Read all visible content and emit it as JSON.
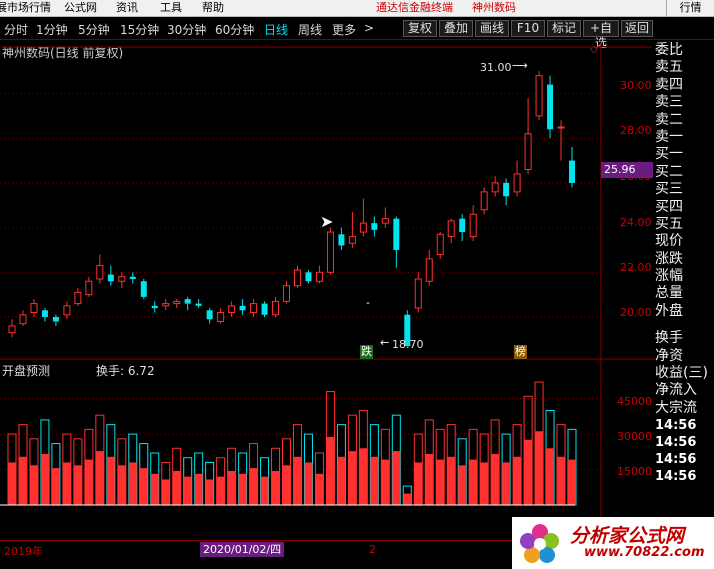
{
  "menubar": {
    "items": [
      "展市场行情",
      "公式网",
      "资讯",
      "工具",
      "帮助"
    ],
    "center_items": [
      "通达信金融终端",
      "神州数码"
    ],
    "right_button": "行情"
  },
  "toolbar": {
    "periods": [
      "分时",
      "1分钟",
      "5分钟",
      "15分钟",
      "30分钟",
      "60分钟",
      "日线",
      "周线",
      "更多",
      ">"
    ],
    "active_period": "日线",
    "buttons": [
      "复权",
      "叠加",
      "画线",
      "F10",
      "标记",
      "+自选",
      "返回"
    ]
  },
  "chart": {
    "title": "神州数码(日线 前复权)",
    "price_axis": [
      "30.00",
      "28.00",
      "26.00",
      "24.00",
      "22.00",
      "20.00"
    ],
    "current_price": "25.96",
    "high_label": "31.00",
    "low_label": "18.70",
    "marker_down": "跌",
    "marker_rank": "榜"
  },
  "sidepanel": {
    "items": [
      "委比",
      "卖五",
      "卖四",
      "卖三",
      "卖二",
      "卖一",
      "买一",
      "买二",
      "买三",
      "买四",
      "买五",
      "现价",
      "涨跌",
      "涨幅",
      "总量",
      "外盘",
      "换手",
      "净资",
      "收益(三)",
      "净流入",
      "大宗流"
    ],
    "times": [
      "14:56",
      "14:56",
      "14:56",
      "14:56"
    ]
  },
  "subpanel": {
    "title": "开盘预测",
    "turnover": "换手: 6.72",
    "axis": [
      "45000",
      "30000",
      "15000"
    ]
  },
  "bottombar": {
    "year": "2019年",
    "date": "2020/01/02/四",
    "month": "2"
  },
  "logo": {
    "text": "分析家公式网",
    "url": "www.70822.com"
  },
  "colors": {
    "up": "#ff3030",
    "down": "#00e5ee",
    "grid": "#7a0000",
    "axis_text": "#cc0000"
  },
  "chart_data": {
    "type": "candlestick",
    "ohlc": [
      [
        19.3,
        19.6,
        19.1,
        19.9
      ],
      [
        19.7,
        20.1,
        19.6,
        20.3
      ],
      [
        20.2,
        20.6,
        20.0,
        20.8
      ],
      [
        20.3,
        20.0,
        19.8,
        20.4
      ],
      [
        20.0,
        19.8,
        19.6,
        20.1
      ],
      [
        20.1,
        20.5,
        19.9,
        20.7
      ],
      [
        20.6,
        21.1,
        20.5,
        21.3
      ],
      [
        21.0,
        21.6,
        20.9,
        21.8
      ],
      [
        21.7,
        22.3,
        21.5,
        22.8
      ],
      [
        21.9,
        21.6,
        21.4,
        22.3
      ],
      [
        21.6,
        21.8,
        21.3,
        22.0
      ],
      [
        21.8,
        21.7,
        21.5,
        22.0
      ],
      [
        21.6,
        20.9,
        20.8,
        21.7
      ],
      [
        20.5,
        20.4,
        20.2,
        20.7
      ],
      [
        20.5,
        20.6,
        20.3,
        20.8
      ],
      [
        20.6,
        20.7,
        20.4,
        20.8
      ],
      [
        20.8,
        20.6,
        20.3,
        20.9
      ],
      [
        20.6,
        20.5,
        20.4,
        20.8
      ],
      [
        20.3,
        19.9,
        19.7,
        20.4
      ],
      [
        19.8,
        20.2,
        19.7,
        20.4
      ],
      [
        20.2,
        20.5,
        20.0,
        20.7
      ],
      [
        20.5,
        20.3,
        20.1,
        20.8
      ],
      [
        20.2,
        20.6,
        20.0,
        20.8
      ],
      [
        20.6,
        20.1,
        20.0,
        20.7
      ],
      [
        20.1,
        20.7,
        20.0,
        20.9
      ],
      [
        20.7,
        21.4,
        20.6,
        21.6
      ],
      [
        21.4,
        22.1,
        21.3,
        22.3
      ],
      [
        22.0,
        21.6,
        21.5,
        22.1
      ],
      [
        21.6,
        22.0,
        21.5,
        22.3
      ],
      [
        22.0,
        23.8,
        21.9,
        24.0
      ],
      [
        23.7,
        23.2,
        23.0,
        24.0
      ],
      [
        23.3,
        23.6,
        23.1,
        24.7
      ],
      [
        23.8,
        24.2,
        23.6,
        25.3
      ],
      [
        24.2,
        23.9,
        23.6,
        24.5
      ],
      [
        24.2,
        24.4,
        24.0,
        24.9
      ],
      [
        24.4,
        23.0,
        22.2,
        24.5
      ],
      [
        20.1,
        18.7,
        18.7,
        20.3
      ],
      [
        20.4,
        21.7,
        20.2,
        22.0
      ],
      [
        21.6,
        22.6,
        21.4,
        23.0
      ],
      [
        22.8,
        23.7,
        22.6,
        23.8
      ],
      [
        23.6,
        24.3,
        23.3,
        24.4
      ],
      [
        24.4,
        23.8,
        23.4,
        24.6
      ],
      [
        23.6,
        24.6,
        23.4,
        25.0
      ],
      [
        24.8,
        25.6,
        24.6,
        25.8
      ],
      [
        25.6,
        26.0,
        25.4,
        26.3
      ],
      [
        26.0,
        25.4,
        25.0,
        26.2
      ],
      [
        25.6,
        26.4,
        25.4,
        27.0
      ],
      [
        26.6,
        28.2,
        26.4,
        29.8
      ],
      [
        29.0,
        30.8,
        28.8,
        31.0
      ],
      [
        30.4,
        28.4,
        28.0,
        30.8
      ],
      [
        28.5,
        28.5,
        27.0,
        28.8
      ],
      [
        27.0,
        26.0,
        25.8,
        27.6
      ]
    ],
    "ylim": [
      18.3,
      31.5
    ],
    "volume": [
      30000,
      34000,
      28000,
      36000,
      26000,
      30000,
      28000,
      32000,
      38000,
      34000,
      28000,
      30000,
      26000,
      22000,
      18000,
      24000,
      20000,
      22000,
      18000,
      20000,
      24000,
      22000,
      26000,
      20000,
      24000,
      28000,
      34000,
      30000,
      22000,
      48000,
      34000,
      38000,
      40000,
      34000,
      32000,
      38000,
      8000,
      30000,
      36000,
      32000,
      34000,
      28000,
      32000,
      30000,
      36000,
      30000,
      34000,
      46000,
      52000,
      40000,
      34000,
      32000
    ],
    "vlim": [
      0,
      55000
    ]
  }
}
